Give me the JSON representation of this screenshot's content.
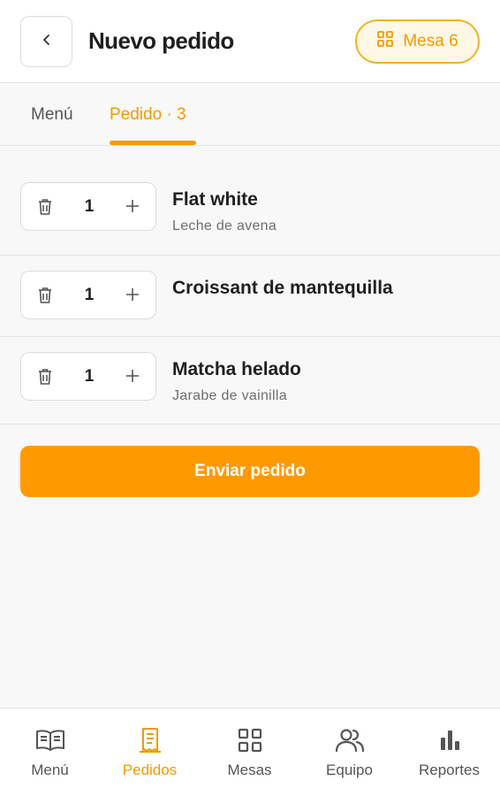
{
  "header": {
    "title": "Nuevo pedido",
    "back_icon": "chevron-left-icon",
    "table_badge": {
      "label": "Mesa 6",
      "icon": "grid-icon"
    }
  },
  "tabs": [
    {
      "label": "Menú",
      "active": false
    },
    {
      "label": "Pedido · 3",
      "active": true
    }
  ],
  "order_items": [
    {
      "quantity": "1",
      "name": "Flat white",
      "note": "Leche de avena"
    },
    {
      "quantity": "1",
      "name": "Croissant de mantequilla",
      "note": ""
    },
    {
      "quantity": "1",
      "name": "Matcha helado",
      "note": "Jarabe de vainilla"
    }
  ],
  "send_button": {
    "label": "Enviar pedido"
  },
  "bottom_nav": [
    {
      "label": "Menú",
      "icon": "book-icon",
      "active": false
    },
    {
      "label": "Pedidos",
      "icon": "receipt-icon",
      "active": true
    },
    {
      "label": "Mesas",
      "icon": "grid-icon",
      "active": false
    },
    {
      "label": "Equipo",
      "icon": "team-icon",
      "active": false
    },
    {
      "label": "Reportes",
      "icon": "bar-chart-icon",
      "active": false
    }
  ],
  "colors": {
    "accent": "#fe9a00",
    "accent_text": "#f29a00",
    "badge_border": "#f3b227",
    "badge_bg": "#fff8e6",
    "text": "#1f1f1f",
    "muted": "#6e6e6e"
  }
}
